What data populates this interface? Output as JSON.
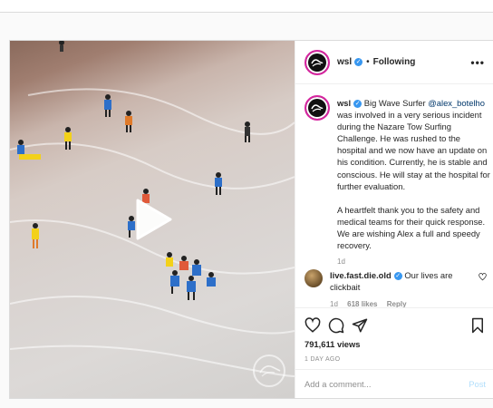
{
  "post": {
    "username": "wsl",
    "verified_icon": "verified-badge-icon",
    "follow_dot": "•",
    "follow_status": "Following",
    "more_label": "•••",
    "caption": {
      "username": "wsl",
      "para1_prefix": "Big Wave Surfer ",
      "mention": "@alex_botelho",
      "para1_rest": " was involved in a very serious incident during the Nazare Tow Surfing Challenge. He was rushed to the hospital and we now have an update on his condition. Currently, he is stable and conscious. He will stay at the hospital for further evaluation.",
      "para2": "A heartfelt thank you to the safety and medical teams for their quick response. We are wishing Alex a full and speedy recovery.",
      "time": "1d"
    },
    "comment": {
      "username": "live.fast.die.old",
      "text": " Our lives are clickbait",
      "time": "1d",
      "likes": "618 likes",
      "reply": "Reply"
    },
    "views": "791,611 views",
    "posted_ago": "1 DAY AGO",
    "add_comment_placeholder": "Add a comment...",
    "post_button": "Post"
  },
  "video": {
    "play_icon": "play-icon",
    "watermark_icon": "wsl-seal-icon"
  },
  "colors": {
    "link": "#00376b",
    "verified": "#3897f0",
    "post_button_disabled": "#b2dffc",
    "muted": "#8e8e8e"
  }
}
